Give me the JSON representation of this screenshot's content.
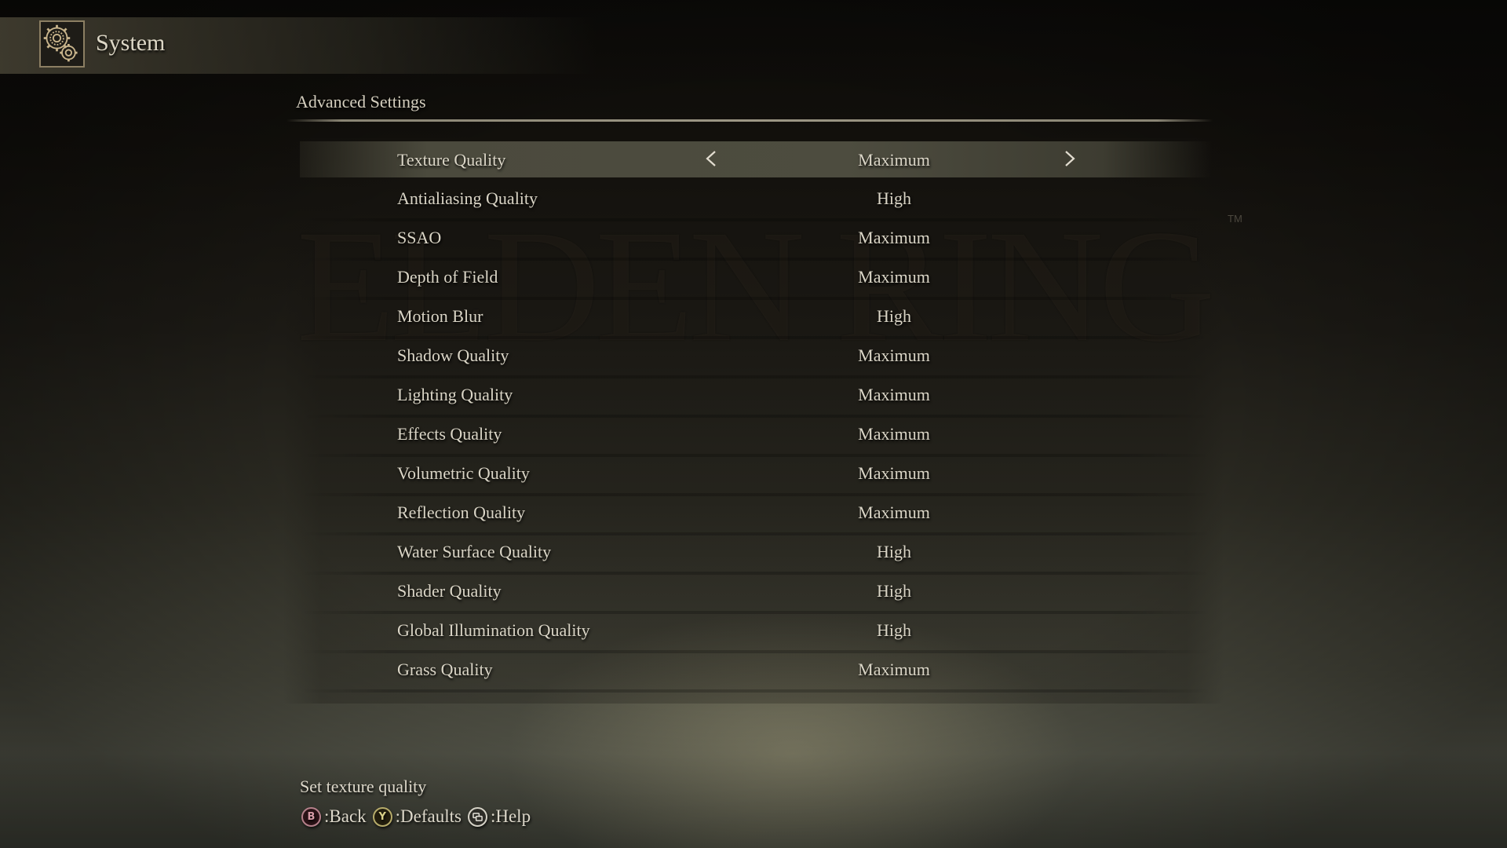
{
  "header": {
    "icon": "gears-icon",
    "title": "System"
  },
  "background": {
    "watermark": "ELDEN RING",
    "trademark": "TM"
  },
  "section": {
    "title": "Advanced Settings"
  },
  "settings": [
    {
      "label": "Texture Quality",
      "value": "Maximum",
      "selected": true
    },
    {
      "label": "Antialiasing Quality",
      "value": "High"
    },
    {
      "label": "SSAO",
      "value": "Maximum"
    },
    {
      "label": "Depth of Field",
      "value": "Maximum"
    },
    {
      "label": "Motion Blur",
      "value": "High"
    },
    {
      "label": "Shadow Quality",
      "value": "Maximum"
    },
    {
      "label": "Lighting Quality",
      "value": "Maximum"
    },
    {
      "label": "Effects Quality",
      "value": "Maximum"
    },
    {
      "label": "Volumetric Quality",
      "value": "Maximum"
    },
    {
      "label": "Reflection Quality",
      "value": "Maximum"
    },
    {
      "label": "Water Surface Quality",
      "value": "High"
    },
    {
      "label": "Shader Quality",
      "value": "High"
    },
    {
      "label": "Global Illumination Quality",
      "value": "High"
    },
    {
      "label": "Grass Quality",
      "value": "Maximum"
    }
  ],
  "selector": {
    "left_icon": "chevron-left-icon",
    "right_icon": "chevron-right-icon"
  },
  "footer": {
    "description": "Set texture quality",
    "hints": [
      {
        "glyph": "B",
        "icon": "b-button-icon",
        "label": ":Back"
      },
      {
        "glyph": "Y",
        "icon": "y-button-icon",
        "label": ":Defaults"
      },
      {
        "glyph": "⧉",
        "icon": "view-button-icon",
        "label": ":Help"
      }
    ]
  },
  "colors": {
    "text": "#dad5c6",
    "highlight": "#4d4c3f",
    "b_button": "#b4808a",
    "y_button": "#b6ab6a"
  }
}
